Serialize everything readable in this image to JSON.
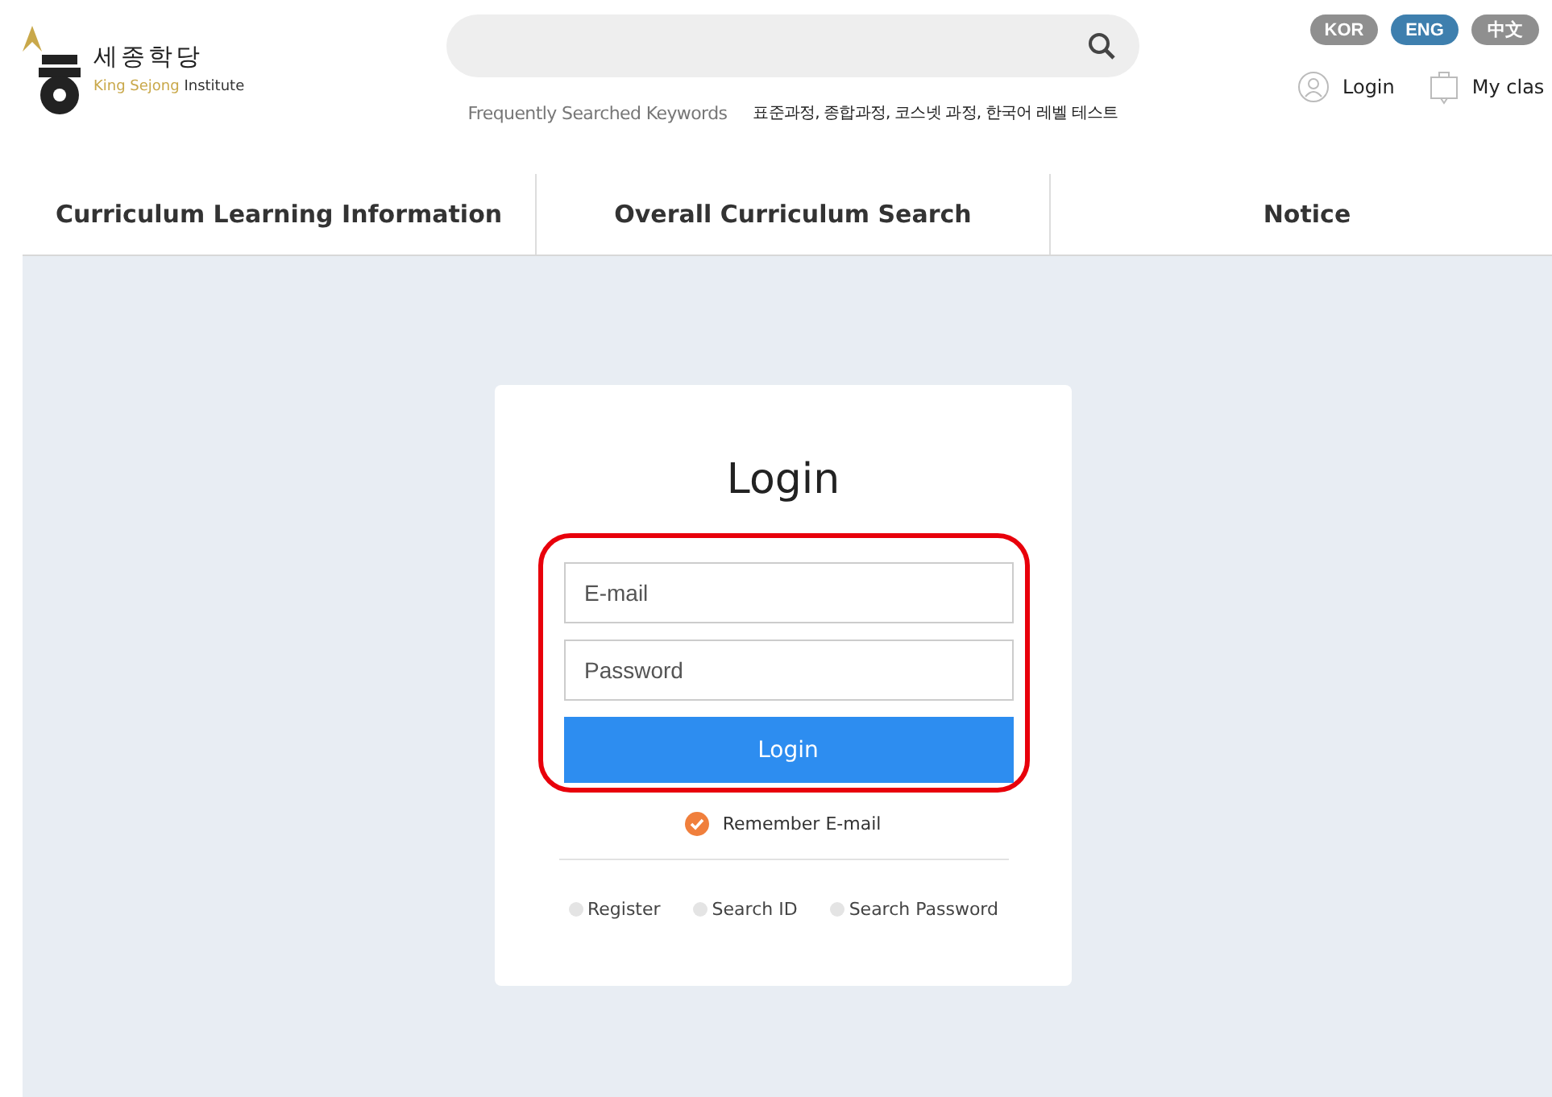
{
  "logo": {
    "korean": "세종학당",
    "english_a": "King Sejong",
    "english_b": "Institute"
  },
  "keywords": {
    "label": "Frequently Searched Keywords",
    "items": "표준과정, 종합과정, 코스넷 과정, 한국어 레벨 테스트"
  },
  "languages": [
    {
      "label": "KOR",
      "selected": false
    },
    {
      "label": "ENG",
      "selected": true
    },
    {
      "label": "中文",
      "selected": false
    }
  ],
  "user_links": [
    {
      "kind": "person",
      "label": "Login"
    },
    {
      "kind": "bag",
      "label": "My clas"
    }
  ],
  "nav": [
    {
      "label": "Curriculum Learning Information"
    },
    {
      "label": "Overall Curriculum Search"
    },
    {
      "label": "Notice"
    }
  ],
  "login": {
    "title": "Login",
    "email_placeholder": "E-mail",
    "password_placeholder": "Password",
    "button": "Login",
    "remember": {
      "label": "Remember E-mail",
      "checked": true
    },
    "links": [
      "Register",
      "Search ID",
      "Search Password"
    ]
  }
}
